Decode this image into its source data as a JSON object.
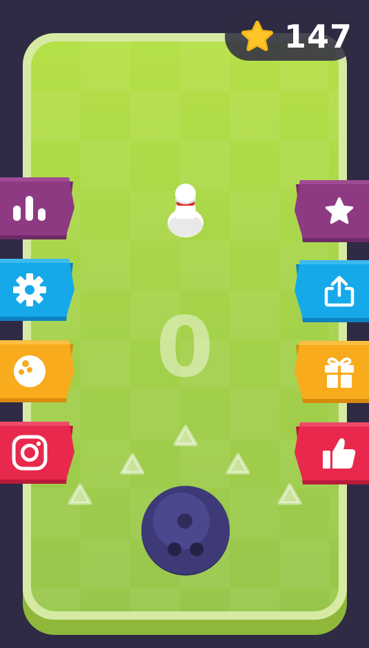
{
  "hud": {
    "star_count": "147"
  },
  "game": {
    "throw_count": "0"
  },
  "menu_left": [
    {
      "id": "leaderboard",
      "icon": "bar-chart-icon",
      "color": "#8e3a82"
    },
    {
      "id": "settings",
      "icon": "gear-icon",
      "color": "#16a9ea"
    },
    {
      "id": "balls",
      "icon": "bowling-ball-icon",
      "color": "#f7ab1d"
    },
    {
      "id": "instagram",
      "icon": "instagram-icon",
      "color": "#e8294d"
    }
  ],
  "menu_right": [
    {
      "id": "rate",
      "icon": "star-icon",
      "color": "#8e3a82"
    },
    {
      "id": "share",
      "icon": "share-icon",
      "color": "#16a9ea"
    },
    {
      "id": "gift",
      "icon": "gift-icon",
      "color": "#f7ab1d"
    },
    {
      "id": "like",
      "icon": "thumbs-up-icon",
      "color": "#e8294d"
    }
  ],
  "colors": {
    "background": "#2f2b45",
    "lane": "#a6d34a",
    "lane_rim": "#d6eaa3",
    "ball": "#3e3a78",
    "pin_stripe": "#e0212d"
  }
}
